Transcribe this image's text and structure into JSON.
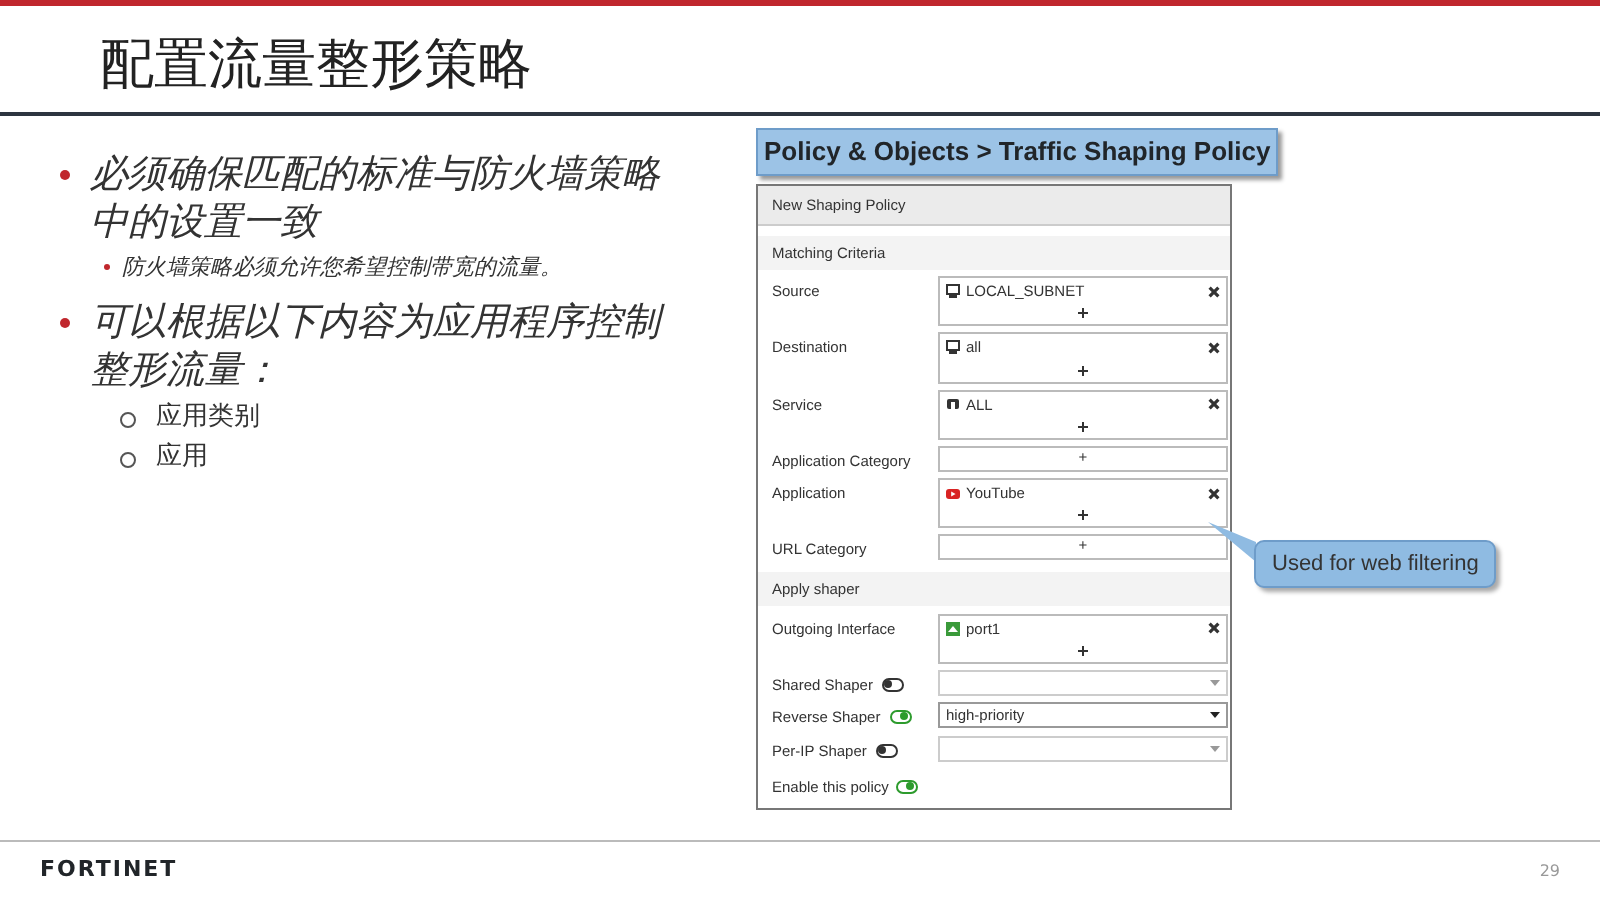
{
  "slide": {
    "title": "配置流量整形策略",
    "page_number": "29",
    "logo": "FORTINET"
  },
  "bullets": [
    {
      "kind": "main",
      "text": "必须确保匹配的标准与防火墙策略中的设置一致",
      "children": [
        {
          "kind": "sub",
          "text": "防火墙策略必须允许您希望控制带宽的流量。"
        }
      ]
    },
    {
      "kind": "main",
      "text": "可以根据以下内容为应用程序控制整形流量：",
      "children": [
        {
          "kind": "circle",
          "text": "应用类别"
        },
        {
          "kind": "circle",
          "text": "应用"
        }
      ]
    }
  ],
  "breadcrumb": "Policy & Objects > Traffic Shaping Policy",
  "dialog": {
    "title": "New Shaping Policy",
    "sections": [
      {
        "title": "Matching Criteria",
        "rows": [
          {
            "kind": "multi",
            "label": "Source",
            "entries": [
              {
                "kind": "address",
                "text": "LOCAL_SUBNET"
              }
            ]
          },
          {
            "kind": "multi",
            "label": "Destination",
            "entries": [
              {
                "kind": "address",
                "text": "all"
              }
            ]
          },
          {
            "kind": "multi",
            "label": "Service",
            "entries": [
              {
                "kind": "service",
                "text": "ALL"
              }
            ]
          },
          {
            "kind": "multi",
            "label": "Application Category",
            "add": "+"
          },
          {
            "kind": "multi",
            "label": "Application",
            "entries": [
              {
                "kind": "app",
                "text": "YouTube"
              }
            ]
          },
          {
            "kind": "multi",
            "label": "URL Category",
            "add": "+",
            "callout": "Used for web filtering"
          }
        ]
      },
      {
        "title": "Apply shaper",
        "rows": [
          {
            "kind": "multi",
            "label": "Outgoing Interface",
            "entries": [
              {
                "kind": "interface",
                "text": "port1"
              }
            ]
          },
          {
            "kind": "toggle-select",
            "label": "Shared Shaper",
            "on": false
          },
          {
            "kind": "toggle-select",
            "label": "Reverse Shaper",
            "on": true,
            "value": "high-priority"
          },
          {
            "kind": "toggle-select",
            "label": "Per-IP Shaper",
            "on": false
          }
        ]
      }
    ],
    "enable": {
      "label": "Enable this policy",
      "on": true
    }
  }
}
